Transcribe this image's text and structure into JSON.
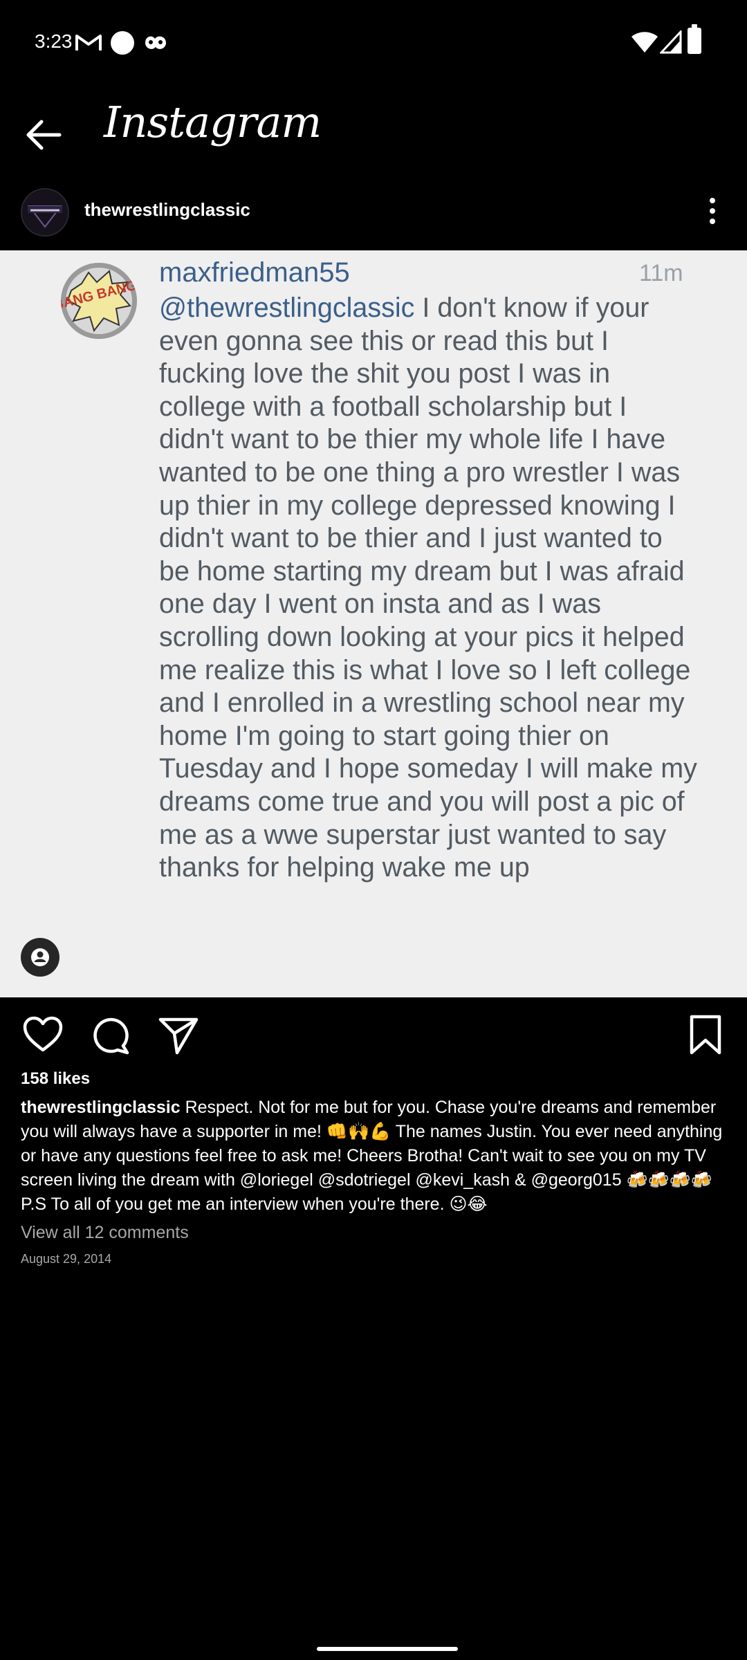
{
  "status_bar": {
    "time": "3:23",
    "icons": [
      "gmail-icon",
      "dot-icon",
      "app-icon",
      "wifi-icon",
      "signal-icon",
      "battery-icon"
    ]
  },
  "app_bar": {
    "title": "Instagram"
  },
  "post": {
    "username": "thewrestlingclassic",
    "screenshot": {
      "commenter": "maxfriedman55",
      "time": "11m",
      "mention": "@thewrestlingclassic",
      "text": " I don't know if your even gonna see this or read this but I fucking love the shit you post I was in college with a football scholarship but I didn't want to be thier my whole life I have wanted to be one thing a pro wrestler I was up thier in my college depressed knowing I didn't want to be thier and I just wanted to be home starting my dream but I was afraid one day I went on insta and as I was scrolling down looking at your pics it helped me realize this is what I love so I left college and I enrolled in a wrestling school near my home I'm going to start going thier on Tuesday and I hope someday I will make my dreams come true and you will post a pic of me as a wwe superstar just wanted to say thanks for helping wake me up",
      "avatar_text": "BANG BANG!"
    },
    "likes": "158 likes",
    "caption_user": "thewrestlingclassic",
    "caption_text": " Respect. Not for me but for you. Chase you're dreams and remember you will always have a supporter in me! 👊🙌💪 The names Justin. You ever need anything or have any questions feel free to ask me! Cheers Brotha!  Can't wait to see you on my TV screen living the dream with @loriegel @sdotriegel @kevi_kash & @georg015 🍻🍻🍻🍻 P.S To all of you get me an interview when you're there. 😉😂",
    "view_comments": "View all 12 comments",
    "date": "August 29, 2014"
  }
}
